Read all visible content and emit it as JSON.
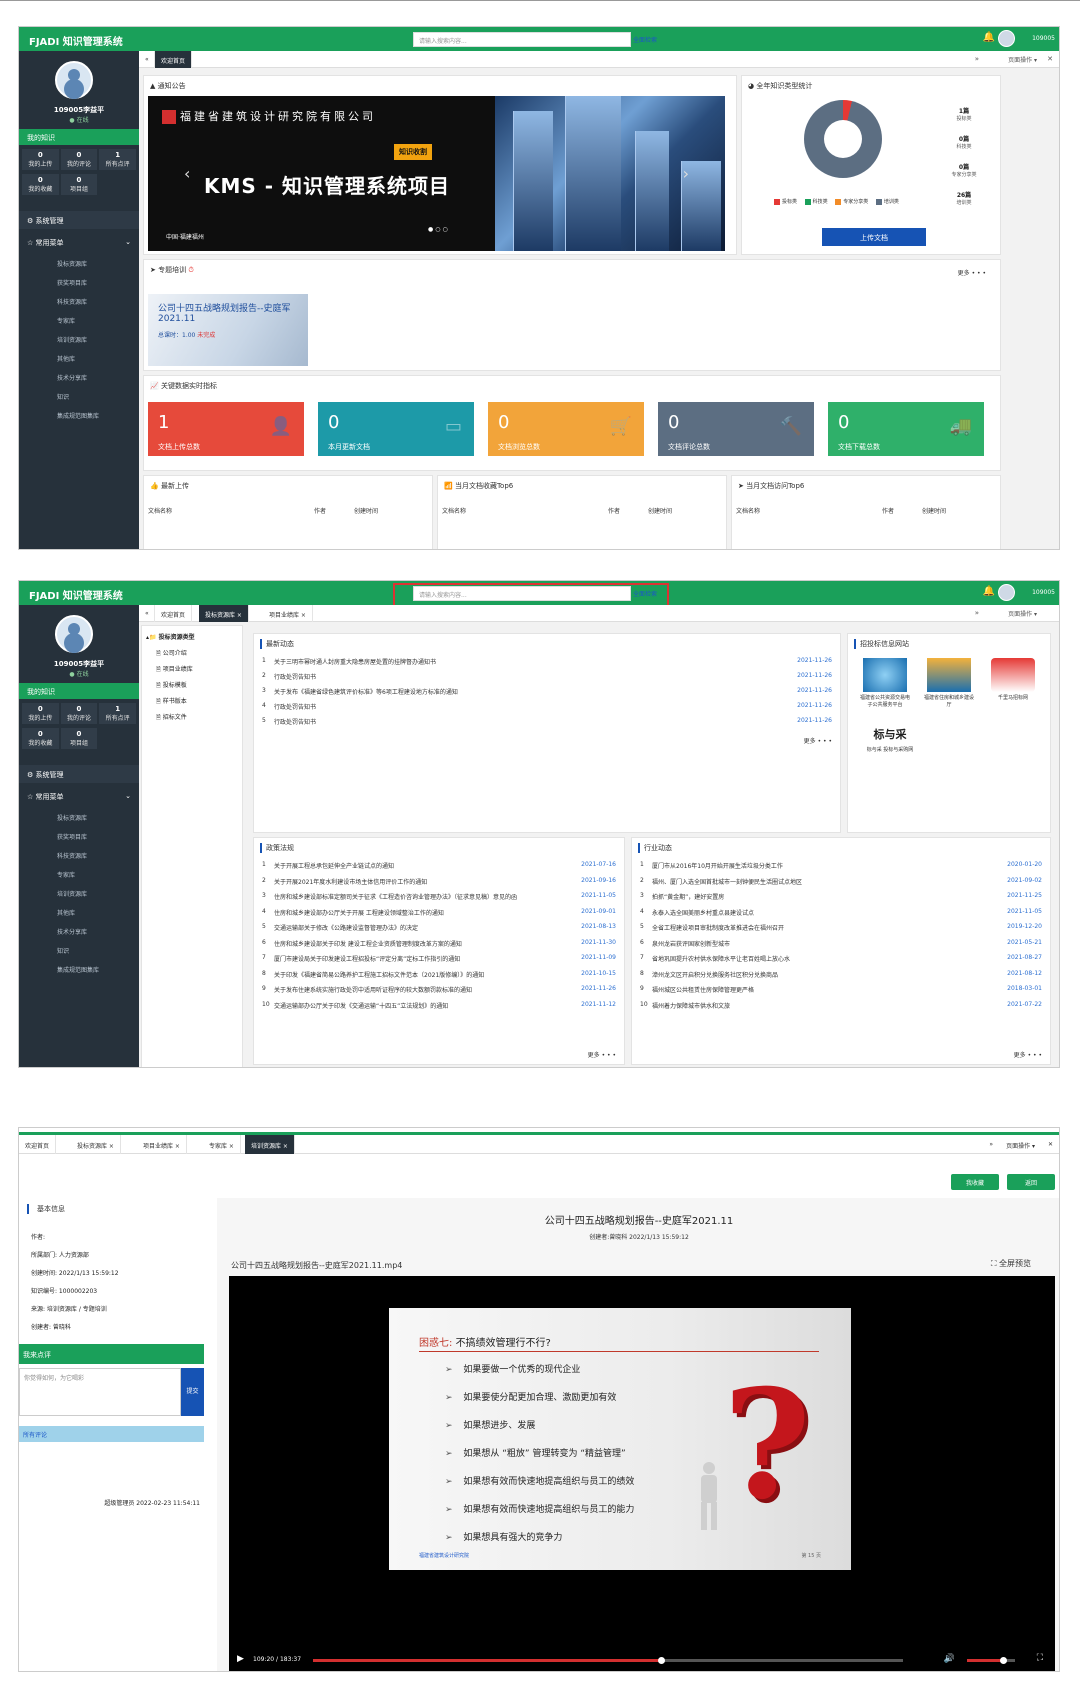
{
  "app": {
    "brand": "FJADI 知识管理系统",
    "search_placeholder": "请输入搜索内容...",
    "search_link": "全面检索",
    "user": "109005",
    "avatar": "user-avatar"
  },
  "sidebar": {
    "name": "109005李益平",
    "status": "● 在线",
    "my_knowledge": "我的知识",
    "stats": [
      {
        "value": "0",
        "label": "我的上传"
      },
      {
        "value": "0",
        "label": "我的评论"
      },
      {
        "value": "1",
        "label": "所有点评"
      },
      {
        "value": "0",
        "label": "我的收藏"
      },
      {
        "value": "0",
        "label": "项目组"
      }
    ],
    "system_menu": "系统管理",
    "common_menu": "常用菜单",
    "items": [
      "投标资源库",
      "获奖项目库",
      "科技资源库",
      "专家库",
      "培训资源库",
      "其他库",
      "技术分享库",
      "知识",
      "集成规范图集库"
    ]
  },
  "screen1": {
    "tabs": [
      "欢迎首页"
    ],
    "page_ops": "页面操作",
    "notice_title": "通知公告",
    "banner": {
      "company": "福建省建筑设计研究院有限公司",
      "tag": "知识收割",
      "headline": "KMS - 知识管理系统项目",
      "place": "中国·福建福州"
    },
    "stats_title": "全年知识类型统计",
    "side_stats": [
      {
        "value": "1篇",
        "label": "投标类"
      },
      {
        "value": "0篇",
        "label": "科技类"
      },
      {
        "value": "0篇",
        "label": "专家分享类"
      },
      {
        "value": "26篇",
        "label": "培训类"
      }
    ],
    "legend": [
      "投标类",
      "科技类",
      "专家分享类",
      "培训类"
    ],
    "upload_btn": "上传文档",
    "training_title": "专题培训",
    "more": "更多 • • •",
    "course": {
      "title": "公司十四五战略规划报告--史庭军",
      "date": "2021.11",
      "hours": "总课时：1.00",
      "status": "未完成"
    },
    "indicators_title": "关键数据实时指标",
    "kpis": [
      {
        "value": "1",
        "label": "文档上传总数",
        "color": "#e64a3b"
      },
      {
        "value": "0",
        "label": "本月更新文档",
        "color": "#1d9aa8"
      },
      {
        "value": "0",
        "label": "文档浏览总数",
        "color": "#f2a43a"
      },
      {
        "value": "0",
        "label": "文档评论总数",
        "color": "#5c6e82"
      },
      {
        "value": "0",
        "label": "文档下载总数",
        "color": "#2fb06a"
      }
    ],
    "lists": [
      {
        "title": "最新上传",
        "cols": [
          "文档名称",
          "作者",
          "创建时间"
        ]
      },
      {
        "title": "当月文档收藏Top6",
        "cols": [
          "文档名称",
          "作者",
          "创建时间"
        ]
      },
      {
        "title": "当月文档访问Top6",
        "cols": [
          "文档名称",
          "作者",
          "创建时间"
        ]
      }
    ]
  },
  "screen2": {
    "tabs": [
      "欢迎首页",
      "投标资源库 ×",
      "项目业绩库 ×"
    ],
    "page_ops": "页面操作",
    "tree_root": "投标资源类型",
    "tree": [
      "公司介绍",
      "项目业绩库",
      "投标模板",
      "样书版本",
      "招标文件"
    ],
    "latest_title": "最新动态",
    "latest": [
      {
        "t": "关于三明市幂时通人封房重大隐患房屋处置的挂牌督办通知书",
        "d": "2021-11-26"
      },
      {
        "t": "行政处罚告知书",
        "d": "2021-11-26"
      },
      {
        "t": "关于发布《福建省绿色建筑评价标准》等6项工程建设地方标准的通知",
        "d": "2021-11-26"
      },
      {
        "t": "行政处罚告知书",
        "d": "2021-11-26"
      },
      {
        "t": "行政处罚告知书",
        "d": "2021-11-26"
      }
    ],
    "sites_title": "招投标信息网站",
    "sites": [
      "福建省公共资源交易电子公共服务平台",
      "福建省住房和城乡建设厅",
      "千里马招标网",
      "标与采 投标与采购网"
    ],
    "policy_title": "政策法规",
    "policy": [
      {
        "t": "关于开展工程总承包延伸全产业链试点的通知",
        "d": "2021-07-16"
      },
      {
        "t": "关于开展2021年度水利建设市场主体信用评价工作的通知",
        "d": "2021-09-16"
      },
      {
        "t": "住房和城乡建设部标准定额司关于征求《工程造价咨询业管理办法》（征求意见稿）意见的函",
        "d": "2021-11-05"
      },
      {
        "t": "住房和城乡建设部办公厅关于开展 工程建设领域整治工作的通知",
        "d": "2021-09-01"
      },
      {
        "t": "交通运输部关于修改《公路建设监督管理办法》的决定",
        "d": "2021-08-13"
      },
      {
        "t": "住房和城乡建设部关于印发 建设工程企业资质管理制度改革方案的通知",
        "d": "2021-11-30"
      },
      {
        "t": "厦门市建设局关于印发建设工程招投标“评定分离”定标工作指引的通知",
        "d": "2021-11-09"
      },
      {
        "t": "关于印发《福建省简易公路养护工程施工招标文件范本（2021版修编）》的通知",
        "d": "2021-10-15"
      },
      {
        "t": "关于发布住建系统实施行政处罚中适用听证程序的较大数额罚款标准的通知",
        "d": "2021-11-26"
      },
      {
        "t": "交通运输部办公厅关于印发《交通运输“十四五”立法规划》的通知",
        "d": "2021-11-12"
      }
    ],
    "industry_title": "行业动态",
    "industry": [
      {
        "t": "厦门市从2016年10月开始开展生活垃圾分类工作",
        "d": "2020-01-20"
      },
      {
        "t": "福州、厦门入选全国首批城市一刻钟便民生活圈试点地区",
        "d": "2021-09-02"
      },
      {
        "t": "拍抓“黄金期”，建好安置房",
        "d": "2021-11-25"
      },
      {
        "t": "永泰入选全国美丽乡村重点县建设试点",
        "d": "2021-11-05"
      },
      {
        "t": "全省工程建设项目审批制度改革推进会在福州召开",
        "d": "2019-12-20"
      },
      {
        "t": "泉州龙岩获评国家创新型城市",
        "d": "2021-05-21"
      },
      {
        "t": "省地巩固提升农村供水保障水平让老百姓喝上放心水",
        "d": "2021-08-27"
      },
      {
        "t": "漳州龙文区开启积分兑换服务社区积分兑换商品",
        "d": "2021-08-12"
      },
      {
        "t": "福州城区公共租赁住房保障管理更严格",
        "d": "2018-03-01"
      },
      {
        "t": "福州着力保障城市供水和文旅",
        "d": "2021-07-22"
      }
    ],
    "more": "更多 • • •"
  },
  "screen3": {
    "tabs": [
      "欢迎首页",
      "投标资源库 ×",
      "项目业绩库 ×",
      "专家库 ×",
      "培训资源库 ×"
    ],
    "page_ops": "页面操作",
    "btn_back": "返回",
    "btn_fav": "我收藏",
    "info_title": "基本信息",
    "info": [
      "作者:",
      "所属部门: 人力资源部",
      "创建时间: 2022/1/13 15:59:12",
      "知识编号: 1000002203",
      "来源: 培训资源库 / 专题培训",
      "创建者: 曾晓科"
    ],
    "comment_title": "我来点评",
    "comment_placeholder": "你觉得如何，为它喝彩",
    "submit": "提交",
    "all_comments": "所有评论",
    "comment_meta": "超级管理员 2022-02-23 11:54:11",
    "video_title": "公司十四五战略规划报告--史庭军2021.11",
    "video_meta": "创建者:曾晓科   2022/1/13 15:59:12",
    "file_name": "公司十四五战略规划报告--史庭军2021.11.mp4",
    "full_preview": "全屏预览",
    "slide_head": "困惑七:",
    "slide_head_text": "不搞绩效管理行不行?",
    "bullets": [
      "如果要做一个优秀的现代企业",
      "如果要使分配更加合理、激励更加有效",
      "如果想进步、发展",
      "如果想从 “粗放” 管理转变为 “精益管理”",
      "如果想有效而快速地提高组织与员工的绩效",
      "如果想有效而快速地提高组织与员工的能力",
      "如果想具有强大的竞争力"
    ],
    "slide_logo": "福建省建筑设计研究院",
    "slide_page": "第 15 页",
    "time": "109:20 / 183:37",
    "progress": 0.59,
    "volume": 0.75
  }
}
